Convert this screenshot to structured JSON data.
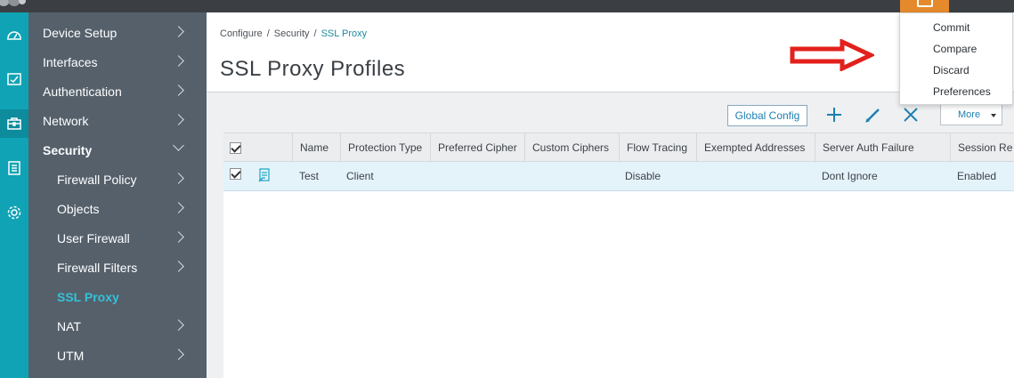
{
  "sidebar": {
    "items": [
      {
        "label": "Device Setup"
      },
      {
        "label": "Interfaces"
      },
      {
        "label": "Authentication"
      },
      {
        "label": "Network"
      },
      {
        "label": "Security"
      },
      {
        "label": "Firewall Policy"
      },
      {
        "label": "Objects"
      },
      {
        "label": "User Firewall"
      },
      {
        "label": "Firewall Filters"
      },
      {
        "label": "SSL Proxy"
      },
      {
        "label": "NAT"
      },
      {
        "label": "UTM"
      }
    ]
  },
  "rail": {
    "icons": [
      "dashboard-icon",
      "monitor-icon",
      "configure-icon",
      "reports-icon",
      "settings-icon"
    ]
  },
  "breadcrumb": {
    "items": [
      "Configure",
      "Security",
      "SSL Proxy"
    ],
    "separator": "/"
  },
  "page": {
    "title": "SSL Proxy Profiles"
  },
  "toolbar": {
    "global_config_label": "Global Config",
    "more_label": "More"
  },
  "table": {
    "columns": [
      "Name",
      "Protection Type",
      "Preferred Cipher",
      "Custom Ciphers",
      "Flow Tracing",
      "Exempted Addresses",
      "Server Auth Failure",
      "Session Re"
    ],
    "rows": [
      {
        "name": "Test",
        "protection_type": "Client",
        "preferred_cipher": "",
        "custom_ciphers": "",
        "flow_tracing": "Disable",
        "exempted_addresses": "",
        "server_auth_failure": "Dont Ignore",
        "session_re": "Enabled"
      }
    ]
  },
  "commit_menu": {
    "items": [
      "Commit",
      "Compare",
      "Discard",
      "Preferences"
    ]
  },
  "colors": {
    "rail": "#0fa3b5",
    "sidebar": "#55606b",
    "active_nav": "#34c1d8",
    "accent_orange": "#e58a2c",
    "selected_row": "#e4f3fa",
    "annotation_arrow": "#e3201b"
  }
}
